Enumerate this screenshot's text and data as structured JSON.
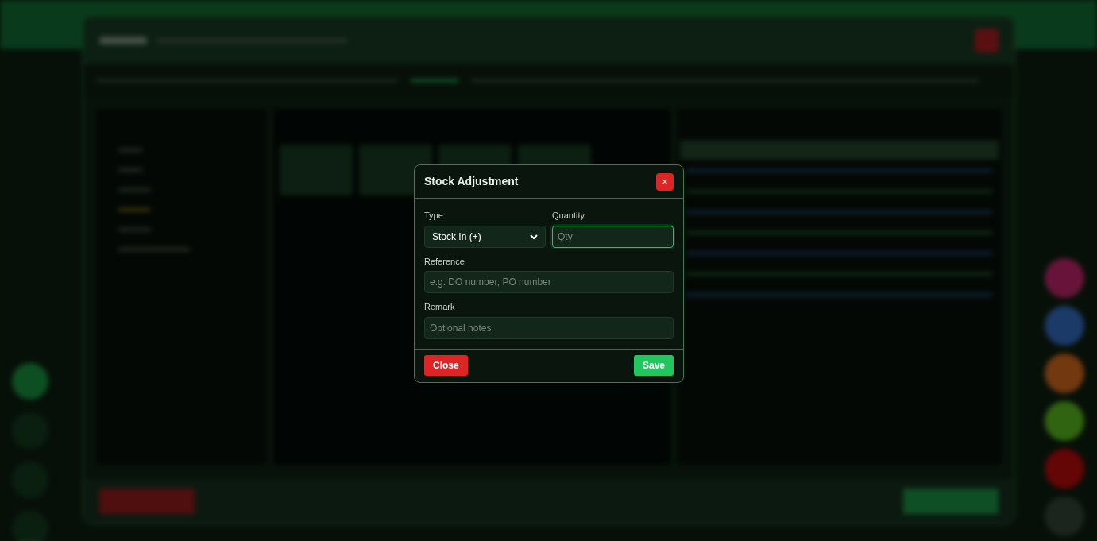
{
  "dialog": {
    "title": "Stock Adjustment",
    "close_button": "×",
    "rows": [
      [
        {
          "kind": "select",
          "label": "Type",
          "value": "Stock In (+)",
          "focused": false
        },
        {
          "kind": "input",
          "label": "Quantity",
          "placeholder": "Qty",
          "focused": true
        }
      ],
      [
        {
          "kind": "input",
          "label": "Reference",
          "placeholder": "e.g. DO number, PO number",
          "focused": false
        }
      ],
      [
        {
          "kind": "input",
          "label": "Remark",
          "placeholder": "Optional notes",
          "focused": false
        }
      ]
    ],
    "buttons": [
      {
        "label": "Close",
        "kind": "danger"
      },
      {
        "label": "Save",
        "kind": "primary"
      }
    ]
  }
}
